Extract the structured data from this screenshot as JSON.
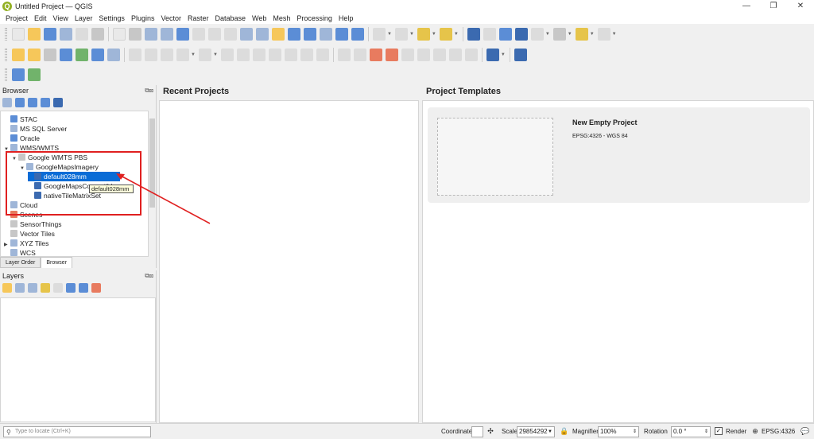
{
  "window": {
    "title": "Untitled Project — QGIS",
    "app_icon_letter": "Q",
    "minimize_glyph": "—",
    "maximize_glyph": "❐",
    "close_glyph": "✕"
  },
  "menubar": {
    "items": [
      "Project",
      "Edit",
      "View",
      "Layer",
      "Settings",
      "Plugins",
      "Vector",
      "Raster",
      "Database",
      "Web",
      "Mesh",
      "Processing",
      "Help"
    ]
  },
  "browser": {
    "title": "Browser",
    "items": [
      {
        "label": "STAC",
        "icon": "stac-icon"
      },
      {
        "label": "MS SQL Server",
        "icon": "mssql-icon"
      },
      {
        "label": "Oracle",
        "icon": "oracle-icon"
      },
      {
        "label": "WMS/WMTS",
        "icon": "wms-icon"
      },
      {
        "label": "Google WMTS PBS",
        "icon": "connection-icon"
      },
      {
        "label": "GoogleMapsImagery",
        "icon": "globe-icon"
      },
      {
        "label": "default028mm",
        "icon": "tile-layer-icon"
      },
      {
        "label": "GoogleMapsCompatible",
        "icon": "tile-layer-icon"
      },
      {
        "label": "nativeTileMatrixSet",
        "icon": "tile-layer-icon"
      },
      {
        "label": "Cloud",
        "icon": "cloud-icon"
      },
      {
        "label": "Scenes",
        "icon": "scenes-icon"
      },
      {
        "label": "SensorThings",
        "icon": "sensor-icon"
      },
      {
        "label": "Vector Tiles",
        "icon": "vector-tiles-icon"
      },
      {
        "label": "XYZ Tiles",
        "icon": "xyz-icon"
      },
      {
        "label": "WCS",
        "icon": "wcs-icon"
      }
    ],
    "tooltip": "default028mm",
    "tabs": [
      "Layer Order",
      "Browser"
    ]
  },
  "layers": {
    "title": "Layers"
  },
  "welcome": {
    "recent_title": "Recent Projects",
    "templates_title": "Project Templates",
    "template_name": "New Empty Project",
    "template_crs": "EPSG:4326 - WGS 84"
  },
  "statusbar": {
    "locator_placeholder": "Type to locate (Ctrl+K)",
    "coordinate_label": "Coordinate",
    "coordinate_value": "",
    "scale_label": "Scale",
    "scale_value": "29854292",
    "magnifier_label": "Magnifier",
    "magnifier_value": "100%",
    "rotation_label": "Rotation",
    "rotation_value": "0.0 °",
    "render_label": "Render",
    "render_checked": true,
    "crs_label": "EPSG:4326"
  },
  "annotation_color": "#e02020",
  "selection_color": "#0a6cd6"
}
